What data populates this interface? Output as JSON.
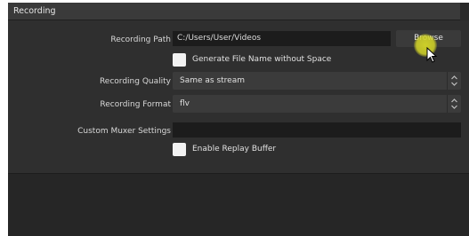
{
  "group": {
    "title": "Recording"
  },
  "recording_path": {
    "label": "Recording Path",
    "value": "C:/Users/User/Videos",
    "browse_label": "Browse"
  },
  "generate_filename": {
    "label": "Generate File Name without Space",
    "checked": false
  },
  "recording_quality": {
    "label": "Recording Quality",
    "value": "Same as stream"
  },
  "recording_format": {
    "label": "Recording Format",
    "value": "flv"
  },
  "custom_muxer": {
    "label": "Custom Muxer Settings",
    "value": ""
  },
  "replay_buffer": {
    "label": "Enable Replay Buffer",
    "checked": false
  },
  "colors": {
    "panel": "#2f2f2f",
    "field": "#1c1c1c",
    "cursor_highlight": "#d4d628"
  },
  "icons": {
    "select_arrows": "updown-chevron-icon",
    "cursor": "mouse-pointer-icon"
  }
}
